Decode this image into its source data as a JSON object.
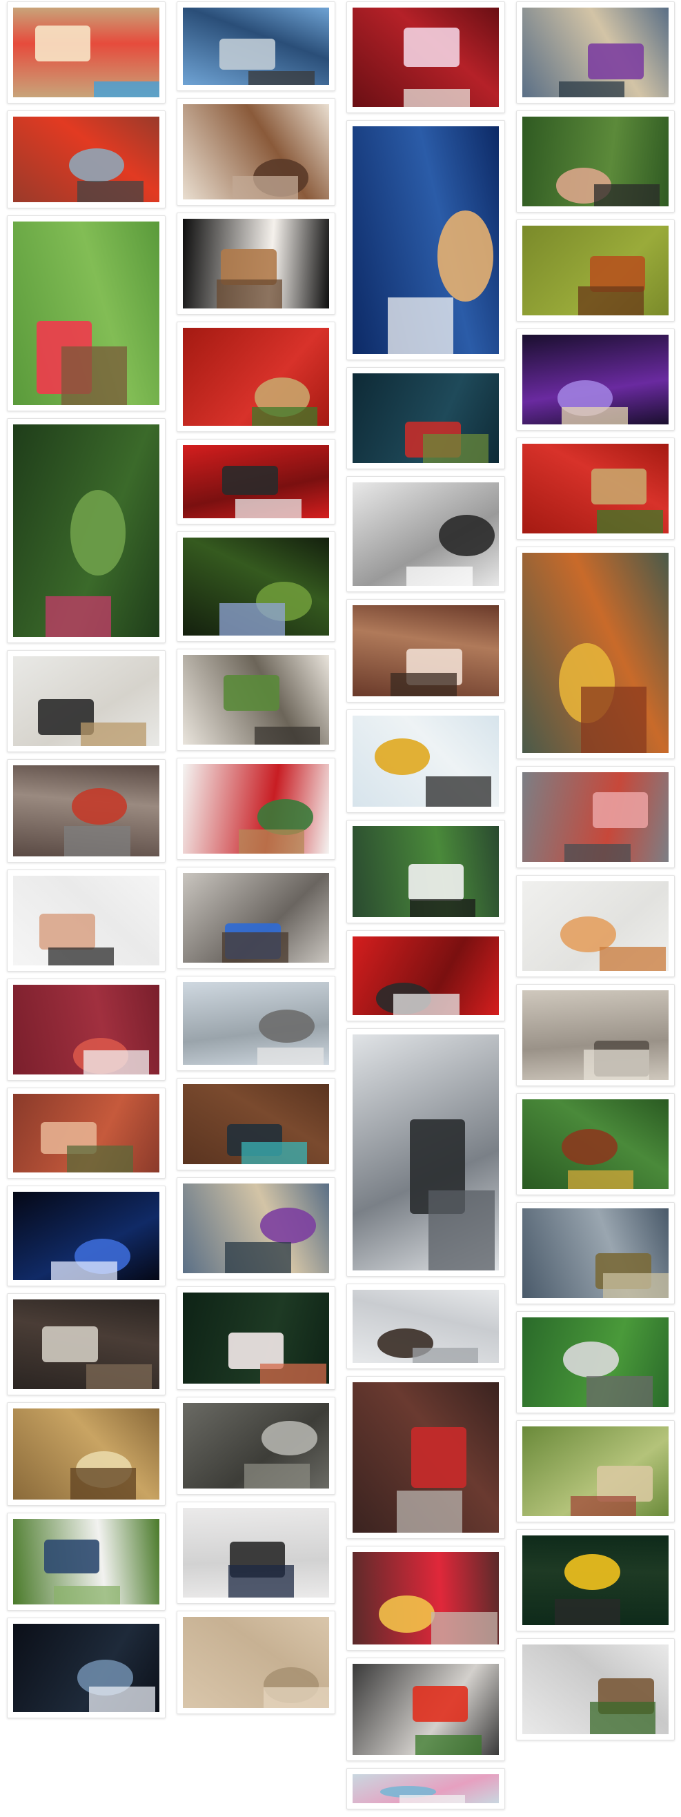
{
  "gallery": {
    "columns": [
      {
        "items": [
          {
            "icon": "gingerbread-candy-photo",
            "colors": [
              "#c8a47a",
              "#e64b3c",
              "#f7e4c6",
              "#3aa1e2"
            ]
          },
          {
            "icon": "red-tree-lava-photo",
            "colors": [
              "#9a3a2a",
              "#e23a22",
              "#8fa6b7",
              "#444444"
            ]
          },
          {
            "icon": "hummingbird-feeder-photo",
            "colors": [
              "#5a9a3b",
              "#82bd55",
              "#ef3b4c",
              "#7a5a3a"
            ]
          },
          {
            "icon": "woman-in-orchard-photo",
            "colors": [
              "#1f3d1a",
              "#3b6a2a",
              "#6fa04a",
              "#c63b6a"
            ]
          },
          {
            "icon": "bicycle-against-wall-photo",
            "colors": [
              "#e9e9e6",
              "#d6d3cc",
              "#2b2b2b",
              "#b99a6a"
            ]
          },
          {
            "icon": "parked-cars-graffiti-photo",
            "colors": [
              "#5a4a44",
              "#9a8a80",
              "#c33b2a",
              "#7f7f7f"
            ]
          },
          {
            "icon": "phone-camera-hands-photo",
            "colors": [
              "#f5f5f5",
              "#eaeaea",
              "#d9a58a",
              "#2c2c2c"
            ]
          },
          {
            "icon": "napkin-on-table-photo",
            "colors": [
              "#7a1f2c",
              "#a1303f",
              "#d8564a",
              "#f1f1f1"
            ]
          },
          {
            "icon": "autumn-forest-photo",
            "colors": [
              "#8a3a2a",
              "#c65a3c",
              "#e6b090",
              "#5a6a3a"
            ]
          },
          {
            "icon": "concert-stage-photo",
            "colors": [
              "#050816",
              "#102a66",
              "#3c6ad6",
              "#e0e8ff"
            ]
          },
          {
            "icon": "cozy-living-room-photo",
            "colors": [
              "#2b2522",
              "#4a3d36",
              "#cfcac0",
              "#7d6a55"
            ]
          },
          {
            "icon": "bright-hallway-photo",
            "colors": [
              "#8a6a3a",
              "#c9a463",
              "#e9d8a9",
              "#5d4020"
            ]
          },
          {
            "icon": "walking-in-park-photo",
            "colors": [
              "#4a7a2a",
              "#f2f2f0",
              "#2e4a70",
              "#8ab26a"
            ]
          },
          {
            "icon": "dark-silhouette-photo",
            "colors": [
              "#0b0f18",
              "#1e2a3a",
              "#6d8aa8",
              "#e9eef5"
            ]
          }
        ]
      },
      {
        "items": [
          {
            "icon": "brooklyn-bridge-photo",
            "colors": [
              "#6fa3d4",
              "#2a4e78",
              "#bfcbd5",
              "#3a3a3a"
            ]
          },
          {
            "icon": "bridge-cables-photo",
            "colors": [
              "#e9ded0",
              "#8a5a3a",
              "#5a3a28",
              "#c3a996"
            ]
          },
          {
            "icon": "latte-art-photo",
            "colors": [
              "#0e0e0e",
              "#f5f1ec",
              "#b07a4a",
              "#6a4a30"
            ]
          },
          {
            "icon": "red-apples-crate-photo",
            "colors": [
              "#a41a12",
              "#d8322a",
              "#c9a46a",
              "#3e7a2a"
            ]
          },
          {
            "icon": "red-sports-car-photo",
            "colors": [
              "#d41e1e",
              "#7a1010",
              "#2a2a2a",
              "#e9e9e9"
            ]
          },
          {
            "icon": "forest-plant-photo",
            "colors": [
              "#14200e",
              "#355a1f",
              "#6e9a3a",
              "#90a4d8"
            ]
          },
          {
            "icon": "forest-cabin-photo",
            "colors": [
              "#e9e4dc",
              "#6c6559",
              "#5a8a3a",
              "#3a3630"
            ]
          },
          {
            "icon": "rose-vase-photo",
            "colors": [
              "#f4f4f2",
              "#c81d23",
              "#3a7a3a",
              "#b48a55"
            ]
          },
          {
            "icon": "moka-pot-stove-photo",
            "colors": [
              "#c9c5bf",
              "#6a6560",
              "#2e6ad6",
              "#4a3a2e"
            ]
          },
          {
            "icon": "boardwalk-pier-photo",
            "colors": [
              "#cfd8e0",
              "#9aa4ab",
              "#6d6d6d",
              "#e6e6e6"
            ]
          },
          {
            "icon": "gift-box-wood-photo",
            "colors": [
              "#5a3420",
              "#7a4a2e",
              "#22303a",
              "#3ab3b6"
            ]
          },
          {
            "icon": "woman-fishing-photo",
            "colors": [
              "#5a6f86",
              "#d3c4a6",
              "#7c3fa0",
              "#2a3a45"
            ]
          },
          {
            "icon": "blossom-branch-photo",
            "colors": [
              "#0e2316",
              "#1e3a24",
              "#f4eaea",
              "#d36a4a"
            ]
          },
          {
            "icon": "rock-wall-photo",
            "colors": [
              "#6a6a64",
              "#3d3d38",
              "#b3b3ad",
              "#8a8a80"
            ]
          },
          {
            "icon": "notebook-tablet-photo",
            "colors": [
              "#ebeaea",
              "#d2d2d2",
              "#2a2a2a",
              "#1e2a44"
            ]
          },
          {
            "icon": "sand-2017-photo",
            "colors": [
              "#d9c6ab",
              "#c7b193",
              "#a89273",
              "#e6d6bf"
            ]
          }
        ]
      },
      {
        "items": [
          {
            "icon": "celebration-cake-photo",
            "colors": [
              "#6a0f14",
              "#b52128",
              "#f2d0e0",
              "#e8e3dc"
            ]
          },
          {
            "icon": "lighthouse-dusk-photo",
            "colors": [
              "#0d2a66",
              "#2b5ca8",
              "#e6b070",
              "#f4f4f4"
            ]
          },
          {
            "icon": "red-umbrella-photo",
            "colors": [
              "#0e2a36",
              "#1f4a5a",
              "#c52e2a",
              "#6a8a3a"
            ]
          },
          {
            "icon": "subway-woman-photo",
            "colors": [
              "#e8e8e8",
              "#9a9a9a",
              "#2a2a2a",
              "#ffffff"
            ]
          },
          {
            "icon": "woman-in-woods-photo",
            "colors": [
              "#6a3a2a",
              "#b07a5a",
              "#f0ddd0",
              "#3a2a20"
            ]
          },
          {
            "icon": "traffic-light-sky-photo",
            "colors": [
              "#d7e4ec",
              "#eef3f5",
              "#e0a820",
              "#2a2a2a"
            ]
          },
          {
            "icon": "phone-in-hand-lake-photo",
            "colors": [
              "#2a4a30",
              "#4a8a3a",
              "#f2f2f2",
              "#1a1a1a"
            ]
          },
          {
            "icon": "red-sports-car-photo",
            "colors": [
              "#d41e1e",
              "#7a1010",
              "#2a2a2a",
              "#e9e9e9"
            ]
          },
          {
            "icon": "foggy-canyon-photo",
            "colors": [
              "#e0e3e6",
              "#7a8087",
              "#2a2d30",
              "#5a5f66"
            ]
          },
          {
            "icon": "bird-in-flight-photo",
            "colors": [
              "#e6e8ea",
              "#c9ccd0",
              "#3a2e26",
              "#a0a4a8"
            ]
          },
          {
            "icon": "mass-hall-building-photo",
            "colors": [
              "#3a2320",
              "#6a3a30",
              "#c92a2a",
              "#b8b3ad"
            ]
          },
          {
            "icon": "red-cocktail-photo",
            "colors": [
              "#5a2a2a",
              "#e0283a",
              "#f2c14a",
              "#c7b7ad"
            ]
          },
          {
            "icon": "cherry-tomatoes-photo",
            "colors": [
              "#3a3a3a",
              "#d3d0cc",
              "#e0301e",
              "#3a7a2a"
            ]
          },
          {
            "icon": "flower-petals-photo",
            "colors": [
              "#c9d7e0",
              "#e6a0c0",
              "#7ab6d4",
              "#f2f2f2"
            ]
          }
        ]
      },
      {
        "items": [
          {
            "icon": "woman-umbrella-river-photo",
            "colors": [
              "#5a6f86",
              "#d3c4a6",
              "#7c3fa0",
              "#2a3a45"
            ]
          },
          {
            "icon": "photographer-camera-photo",
            "colors": [
              "#2f5a22",
              "#5c8a3a",
              "#d9a58a",
              "#2a2a2a"
            ]
          },
          {
            "icon": "brown-shoes-grass-photo",
            "colors": [
              "#7a8a2a",
              "#9aab3a",
              "#b5531e",
              "#6a3a18"
            ]
          },
          {
            "icon": "night-river-bridge-photo",
            "colors": [
              "#1a0f2e",
              "#6a2aa0",
              "#a080e0",
              "#e6d7b0"
            ]
          },
          {
            "icon": "red-apples-crate-photo",
            "colors": [
              "#a41a12",
              "#d8322a",
              "#c9a46a",
              "#3e7a2a"
            ]
          },
          {
            "icon": "autumn-leaves-forest-photo",
            "colors": [
              "#4a5a4a",
              "#c96a2a",
              "#e6b23a",
              "#8a3a1e"
            ]
          },
          {
            "icon": "fairground-street-photo",
            "colors": [
              "#7c7f85",
              "#c7483a",
              "#e9a0a0",
              "#4a4d52"
            ]
          },
          {
            "icon": "bright-wall-floor-photo",
            "colors": [
              "#f0f0ee",
              "#e2e2df",
              "#e3a060",
              "#c97a3a"
            ]
          },
          {
            "icon": "sand-texture-photo",
            "colors": [
              "#cfc8bd",
              "#9a9288",
              "#5a524a",
              "#e6e0d6"
            ]
          },
          {
            "icon": "beer-bottles-photo",
            "colors": [
              "#2a5a22",
              "#4a8a3a",
              "#8a3a1e",
              "#d4a83a"
            ]
          },
          {
            "icon": "sitting-on-hill-photo",
            "colors": [
              "#4a5a6a",
              "#9aa6b0",
              "#7a6a3a",
              "#c9c0a0"
            ]
          },
          {
            "icon": "soccer-field-aerial-photo",
            "colors": [
              "#2a6a2a",
              "#4a9a3a",
              "#d9d9d9",
              "#6a6a6a"
            ]
          },
          {
            "icon": "reading-in-grass-photo",
            "colors": [
              "#6a8a3a",
              "#b4c37a",
              "#d8c9a0",
              "#a04a3a"
            ]
          },
          {
            "icon": "sunflower-woman-photo",
            "colors": [
              "#0e2a1a",
              "#1e3a24",
              "#f2c21e",
              "#2a2a2a"
            ]
          },
          {
            "icon": "cash-briefcase-photo",
            "colors": [
              "#e9e9e9",
              "#c9c9c9",
              "#7a5a3a",
              "#3a6a2a"
            ]
          }
        ]
      }
    ]
  }
}
